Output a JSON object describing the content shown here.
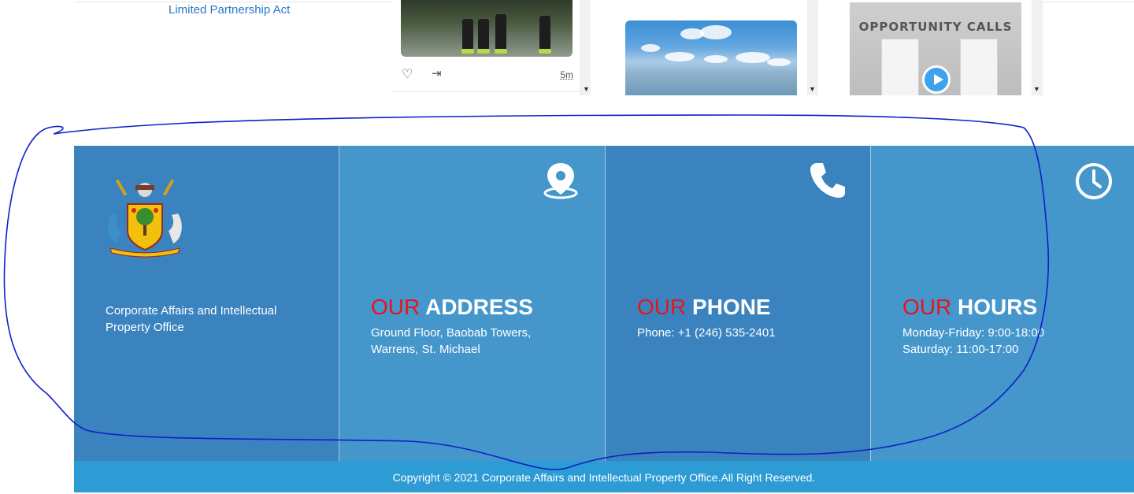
{
  "top": {
    "link_text": "Limited Partnership Act"
  },
  "feed": {
    "cards": [
      {
        "time": "5m",
        "like_icon": "heart-icon",
        "share_icon": "share-icon"
      },
      {
        "image": "sky-photo"
      },
      {
        "image_text": "OPPORTUNITY CALLS",
        "play_icon": "play-icon"
      }
    ]
  },
  "footer": {
    "organization": "Corporate Affairs and Intellectual Property Office",
    "address": {
      "heading_accent": "OUR",
      "heading_main": "ADDRESS",
      "line1": "Ground Floor, Baobab Towers,",
      "line2": "Warrens, St. Michael",
      "icon": "map-pin-icon"
    },
    "phone": {
      "heading_accent": "OUR",
      "heading_main": "PHONE",
      "line1": "Phone: +1 (246) 535-2401",
      "icon": "phone-icon"
    },
    "hours": {
      "heading_accent": "OUR",
      "heading_main": "HOURS",
      "line1": "Monday-Friday: 9:00-18:00",
      "line2": "Saturday: 11:00-17:00",
      "icon": "clock-icon"
    },
    "copyright": "Copyright © 2021 Corporate Affairs and Intellectual Property Office.All Right Reserved."
  },
  "colors": {
    "footer_dark": "#3a83bf",
    "footer_light": "#4496cb",
    "copyright_bar": "#2d9bd4",
    "accent_red": "#e8141b",
    "annotation_blue": "#1020c8"
  }
}
